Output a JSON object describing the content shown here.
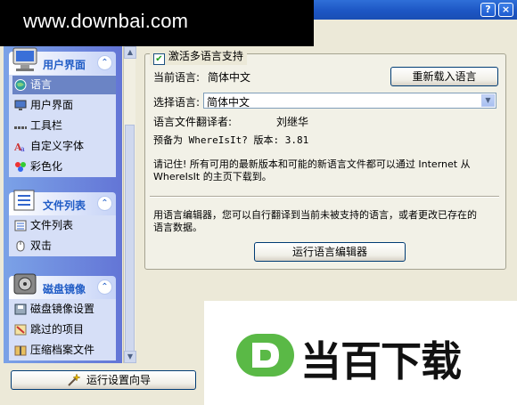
{
  "watermark_top": "www.downbai.com",
  "titlebar": {
    "help_button": "?",
    "close_button": "×"
  },
  "sidebar": {
    "groups": [
      {
        "title": "用户界面",
        "items": [
          {
            "label": "语言",
            "icon": "globe-icon",
            "selected": true
          },
          {
            "label": "用户界面",
            "icon": "monitor-icon"
          },
          {
            "label": "工具栏",
            "icon": "toolbar-icon"
          },
          {
            "label": "自定义字体",
            "icon": "font-icon"
          },
          {
            "label": "彩色化",
            "icon": "palette-icon"
          }
        ]
      },
      {
        "title": "文件列表",
        "items": [
          {
            "label": "文件列表",
            "icon": "file-list-icon"
          },
          {
            "label": "双击",
            "icon": "mouse-icon"
          }
        ]
      },
      {
        "title": "磁盘镜像",
        "items": [
          {
            "label": "磁盘镜像设置",
            "icon": "disk-image-icon"
          },
          {
            "label": "跳过的项目",
            "icon": "skip-icon"
          },
          {
            "label": "压缩档案文件",
            "icon": "archive-icon"
          }
        ]
      }
    ],
    "collapse_glyph": "⌃"
  },
  "language": {
    "enable_multilang_label": "激活多语言支持",
    "enable_multilang_checked": true,
    "current_label": "当前语言:",
    "current_value": "简体中文",
    "reload_button": "重新载入语言",
    "select_label": "选择语言:",
    "select_value": "简体中文",
    "translator_label": "语言文件翻译者:",
    "translator_value": "刘继华",
    "prepared_for": "预备为 WhereIsIt? 版本: 3.81",
    "reminder_line1": "请记住! 所有可用的最新版本和可能的新语言文件都可以通过 Internet 从",
    "reminder_line2": "WhereIsIt 的主页下载到。",
    "editor_line1": "用语言编辑器，您可以自行翻译到当前未被支持的语言，或者更改已存在的",
    "editor_line2": "语言数据。",
    "editor_button": "运行语言编辑器"
  },
  "footer": {
    "wizard_button": "运行设置向导"
  },
  "logo_text": "当百下载",
  "colors": {
    "title_blue": "#1d56c4",
    "sidebar_blue": "#6375d6",
    "logo_green": "#5ab946"
  }
}
